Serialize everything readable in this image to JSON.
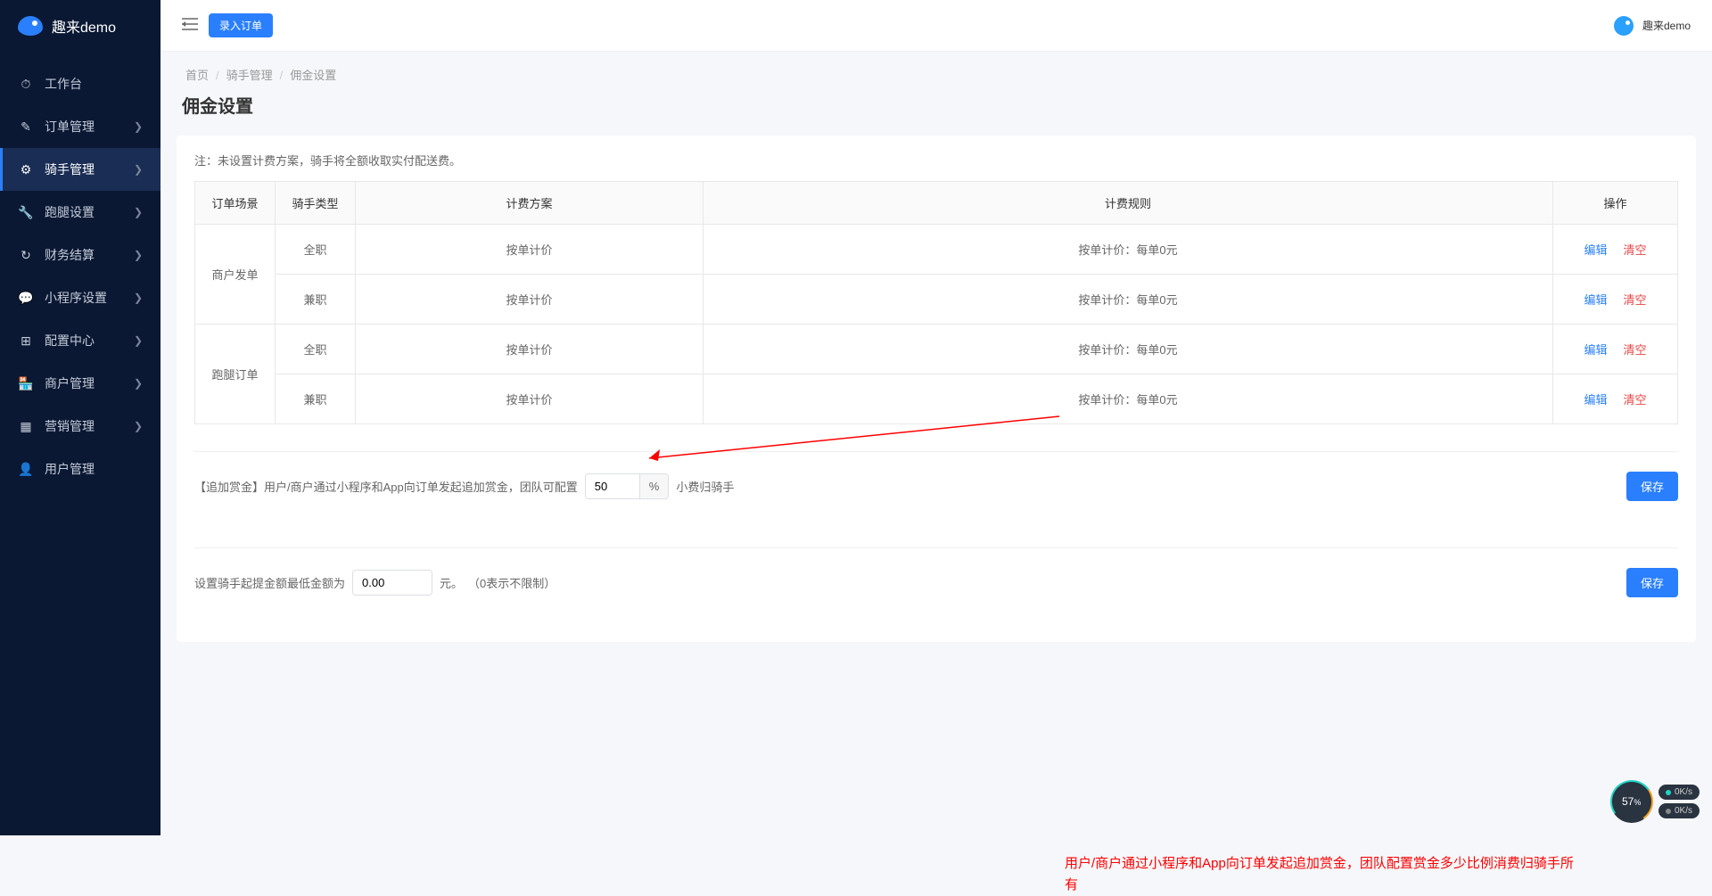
{
  "brand": "趣来demo",
  "header": {
    "order_button": "录入订单",
    "username": "趣来demo"
  },
  "sidebar": {
    "items": [
      {
        "icon": "⏱",
        "label": "工作台",
        "expandable": false,
        "active": false
      },
      {
        "icon": "✎",
        "label": "订单管理",
        "expandable": true,
        "active": false
      },
      {
        "icon": "⚙",
        "label": "骑手管理",
        "expandable": true,
        "active": true
      },
      {
        "icon": "🔧",
        "label": "跑腿设置",
        "expandable": true,
        "active": false
      },
      {
        "icon": "↻",
        "label": "财务结算",
        "expandable": true,
        "active": false
      },
      {
        "icon": "💬",
        "label": "小程序设置",
        "expandable": true,
        "active": false
      },
      {
        "icon": "⊞",
        "label": "配置中心",
        "expandable": true,
        "active": false
      },
      {
        "icon": "🏪",
        "label": "商户管理",
        "expandable": true,
        "active": false
      },
      {
        "icon": "▦",
        "label": "营销管理",
        "expandable": true,
        "active": false
      },
      {
        "icon": "👤",
        "label": "用户管理",
        "expandable": false,
        "active": false
      }
    ]
  },
  "breadcrumb": [
    "首页",
    "骑手管理",
    "佣金设置"
  ],
  "page_title": "佣金设置",
  "note": "注：未设置计费方案，骑手将全额收取实付配送费。",
  "table": {
    "headers": [
      "订单场景",
      "骑手类型",
      "计费方案",
      "计费规则",
      "操作"
    ],
    "groups": [
      {
        "scene": "商户发单",
        "rows": [
          {
            "type": "全职",
            "plan": "按单计价",
            "rule": "按单计价：每单0元"
          },
          {
            "type": "兼职",
            "plan": "按单计价",
            "rule": "按单计价：每单0元"
          }
        ]
      },
      {
        "scene": "跑腿订单",
        "rows": [
          {
            "type": "全职",
            "plan": "按单计价",
            "rule": "按单计价：每单0元"
          },
          {
            "type": "兼职",
            "plan": "按单计价",
            "rule": "按单计价：每单0元"
          }
        ]
      }
    ],
    "actions": {
      "edit": "编辑",
      "clear": "清空"
    }
  },
  "bonus": {
    "label_prefix": "【追加赏金】用户/商户通过小程序和App向订单发起追加赏金，团队可配置",
    "value": "50",
    "suffix": "%",
    "label_suffix": "小费归骑手",
    "save": "保存"
  },
  "withdraw": {
    "label_prefix": "设置骑手起提金额最低金额为",
    "value": "0.00",
    "unit": "元。",
    "hint": "（0表示不限制）",
    "save": "保存"
  },
  "annotation": "用户/商户通过小程序和App向订单发起追加赏金，团队配置赏金多少比例消费归骑手所有",
  "perf": {
    "main": "57",
    "sub": "%",
    "bars": [
      "0K/s",
      "0K/s"
    ]
  }
}
